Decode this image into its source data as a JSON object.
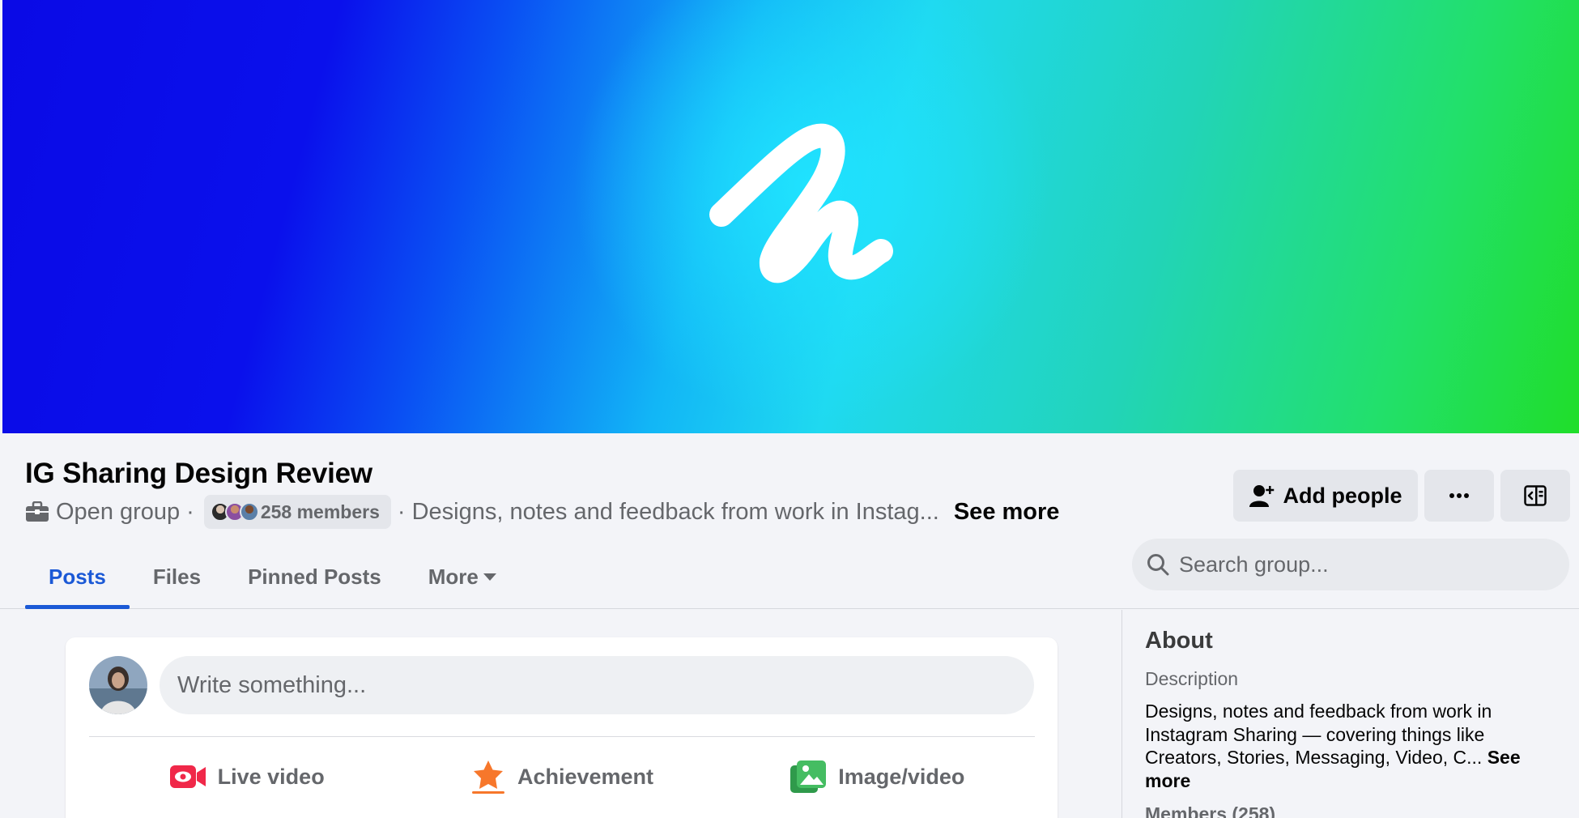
{
  "group": {
    "title": "IG Sharing Design Review",
    "privacy": "Open group",
    "separator": "·",
    "members_label": "258 members",
    "description_short": "· Designs, notes and feedback from work in Instag...",
    "see_more": "See more"
  },
  "header_actions": {
    "add_people": "Add people",
    "more_icon": "ellipsis-icon",
    "panel_icon": "sidebar-panel-icon"
  },
  "tabs": [
    {
      "label": "Posts",
      "active": true
    },
    {
      "label": "Files",
      "active": false
    },
    {
      "label": "Pinned Posts",
      "active": false
    },
    {
      "label": "More",
      "active": false
    }
  ],
  "search": {
    "placeholder": "Search group..."
  },
  "composer": {
    "placeholder": "Write something...",
    "actions": [
      {
        "label": "Live video",
        "icon": "live-video-icon",
        "color": "#f02849"
      },
      {
        "label": "Achievement",
        "icon": "achievement-icon",
        "color": "#f7772b"
      },
      {
        "label": "Image/video",
        "icon": "photo-icon",
        "color": "#45bd62"
      }
    ]
  },
  "about": {
    "title": "About",
    "description_label": "Description",
    "description": "Designs, notes and feedback from work in Instagram Sharing — covering things like Creators, Stories, Messaging, Video, C...",
    "see_more": "See more",
    "members_heading": "Members (258)"
  },
  "colors": {
    "accent": "#1b59d6",
    "background": "#f3f4f8",
    "button_bg": "#e4e6eb",
    "muted_text": "#65676b"
  }
}
